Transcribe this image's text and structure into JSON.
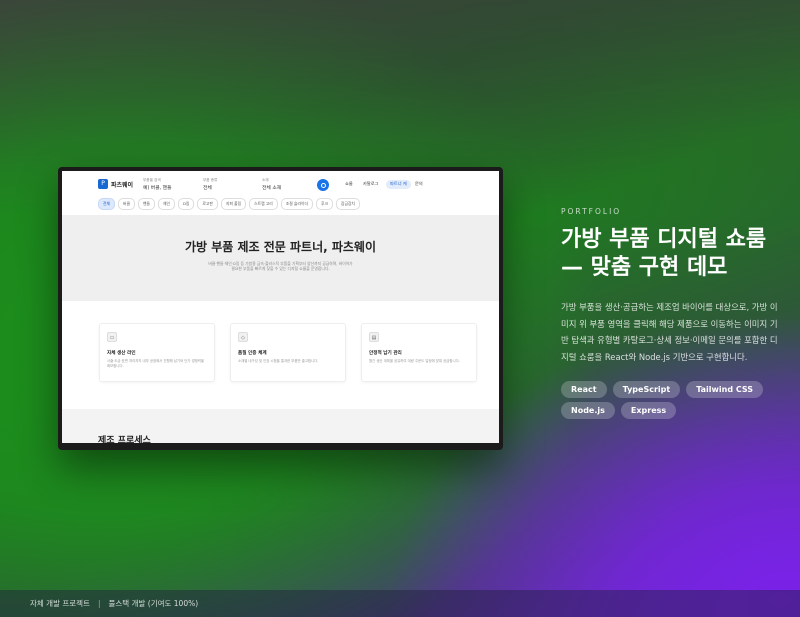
{
  "mockup": {
    "logo": {
      "icon": "P",
      "text": "파츠웨이"
    },
    "fields": [
      {
        "label": "부품을 검색",
        "value": "예) 버클, 핸들"
      },
      {
        "label": "부품 종류",
        "value": "전체"
      },
      {
        "label": "소재",
        "value": "전체 소재"
      }
    ],
    "nav": [
      "쇼룸",
      "카탈로그",
      "파트너 케",
      "문의"
    ],
    "categories": [
      "전체",
      "버클",
      "핸들",
      "체인",
      "D링",
      "로고판",
      "지퍼 풀링",
      "스트랩 고리",
      "조절 슬라이더",
      "후크",
      "잠금장치"
    ],
    "hero": {
      "title": "가방 부품 제조 전문 파트너, 파츠웨이",
      "line1": "버클·핸들·체인·D링 등 가방용 금속·플라스틱 부품을 기획부터 양산까지 공급하며, 바이어가",
      "line2": "필요한 부품을 빠르게 찾을 수 있는 디지털 쇼룸을 운영합니다."
    },
    "features": [
      {
        "icon": "factory",
        "title": "자체 생산 라인",
        "desc": "사출·도금·표면 처리까지 내부 공정에서 진행해 납기와 단가 경쟁력을 확보합니다."
      },
      {
        "icon": "shield",
        "title": "품질 인증 체계",
        "desc": "소재별 내구성 및 인장 시험을 통과한 부품만 출고합니다."
      },
      {
        "icon": "truck",
        "title": "안정적 납기 관리",
        "desc": "월간 생산 계획을 공유하여 대량 주문도 일정에 맞춰 공급합니다."
      }
    ],
    "process_title": "제조 프로세스"
  },
  "right": {
    "eyebrow": "PORTFOLIO",
    "title_line1": "가방 부품 디지털 쇼룸",
    "title_line2": "— 맞춤 구현 데모",
    "description": "가방 부품을 생산·공급하는 제조업 바이어를 대상으로, 가방 이미지 위 부품 영역을 클릭해 해당 제품으로 이동하는 이미지 기반 탐색과 유형별 카탈로그·상세 정보·이메일 문의를 포함한 디지털 쇼룸을 React와 Node.js 기반으로 구현합니다.",
    "tags": [
      "React",
      "TypeScript",
      "Tailwind CSS",
      "Node.js",
      "Express"
    ]
  },
  "footer": {
    "left": "자체 개발 프로젝트",
    "separator": "|",
    "right": "풀스택 개발 (기여도 100%)"
  }
}
